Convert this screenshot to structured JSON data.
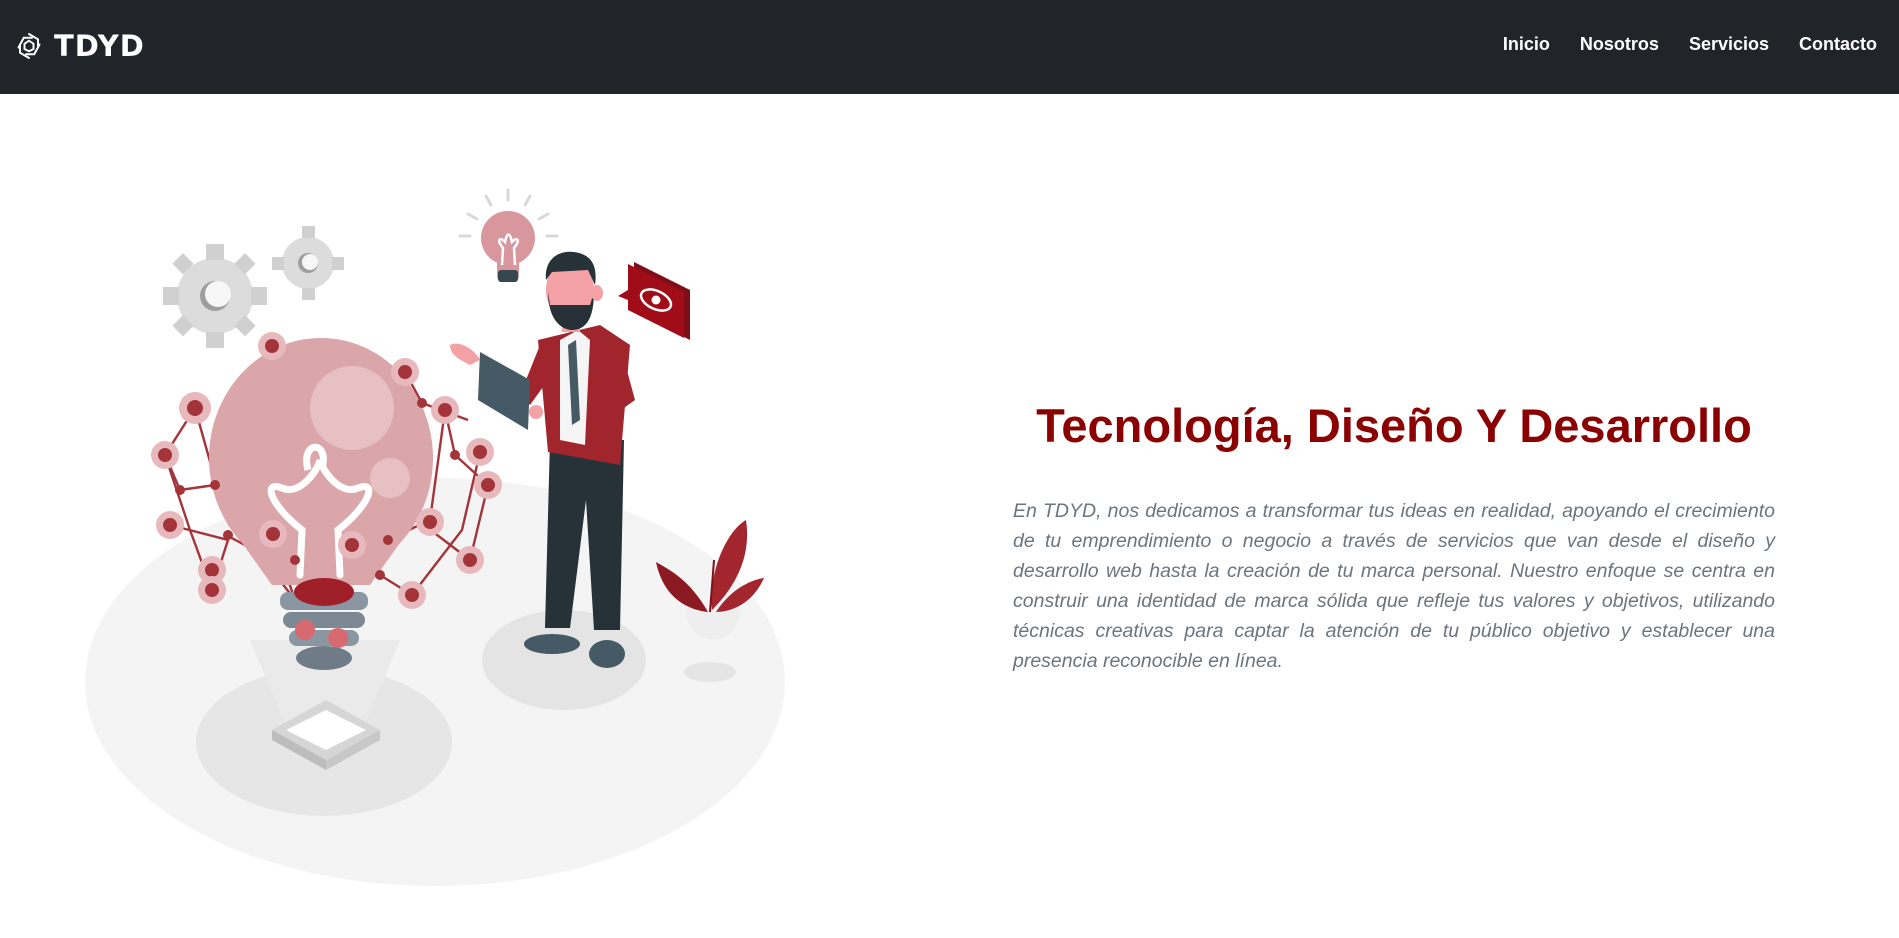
{
  "brand": {
    "name": "TDYD",
    "logo_icon": "tdyd-logo-icon"
  },
  "nav": {
    "items": [
      {
        "label": "Inicio"
      },
      {
        "label": "Nosotros"
      },
      {
        "label": "Servicios"
      },
      {
        "label": "Contacto"
      }
    ]
  },
  "hero": {
    "title": "Tecnología, Diseño Y Desarrollo",
    "paragraph": "En TDYD, nos dedicamos a transformar tus ideas en realidad, apoyando el crecimiento de tu emprendimiento o negocio a través de servicios que van desde el diseño y desarrollo web hasta la creación de tu marca personal. Nuestro enfoque se centra en construir una identidad de marca sólida que refleje tus valores y objetivos, utilizando técnicas creativas para captar la atención de tu público objetivo y establecer una presencia reconocible en línea.",
    "illustration": "innovation-idea-illustration"
  },
  "colors": {
    "navbar_bg": "#212529",
    "accent": "#8b0000",
    "paragraph_text": "#6c757d",
    "background": "#ffffff"
  }
}
